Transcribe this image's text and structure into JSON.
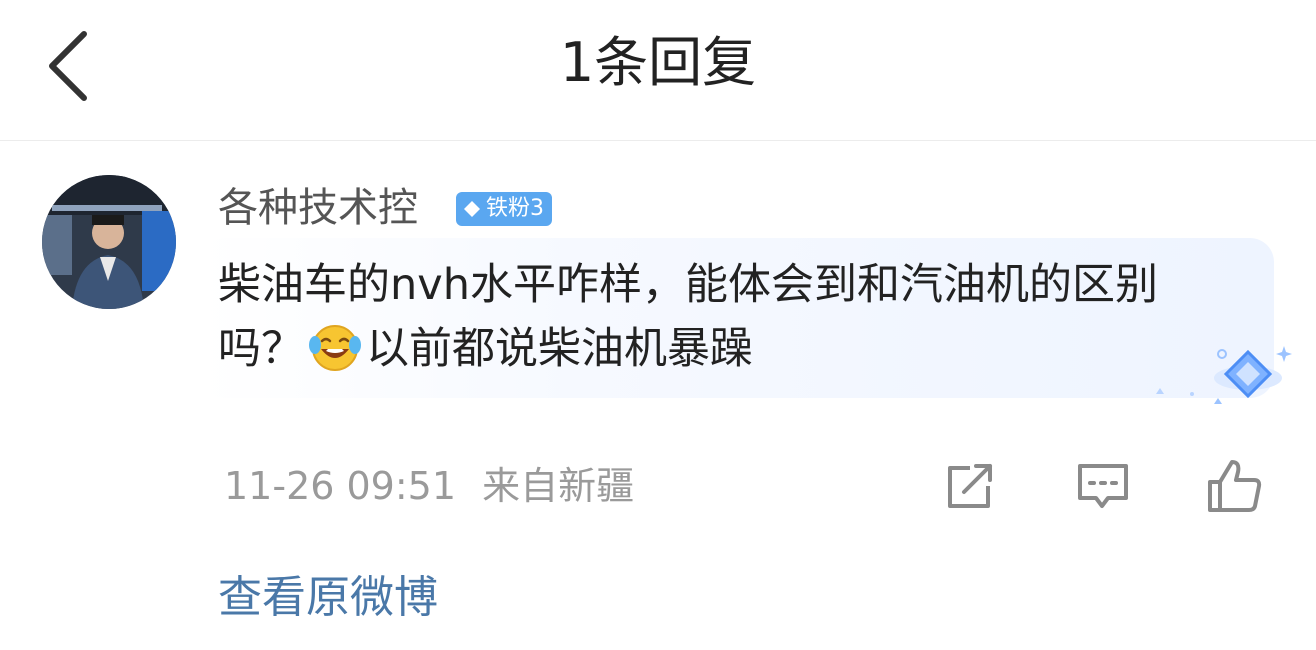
{
  "header": {
    "title": "1条回复"
  },
  "comment": {
    "username": "各种技术控",
    "badge": "铁粉3",
    "text_part1": "柴油车的nvh水平咋样，能体会到和汽油机的区别吗？",
    "text_part2": "以前都说柴油机暴躁",
    "emoji": "laughing-crying-emoji",
    "timestamp": "11-26 09:51",
    "location": "来自新疆"
  },
  "actions": {
    "share": "share-icon",
    "comment": "comment-icon",
    "like": "like-icon"
  },
  "footer": {
    "view_original": "查看原微博"
  },
  "colors": {
    "link": "#4a78a8",
    "badge": "#5aa7f0",
    "meta": "#9a9a9a"
  }
}
